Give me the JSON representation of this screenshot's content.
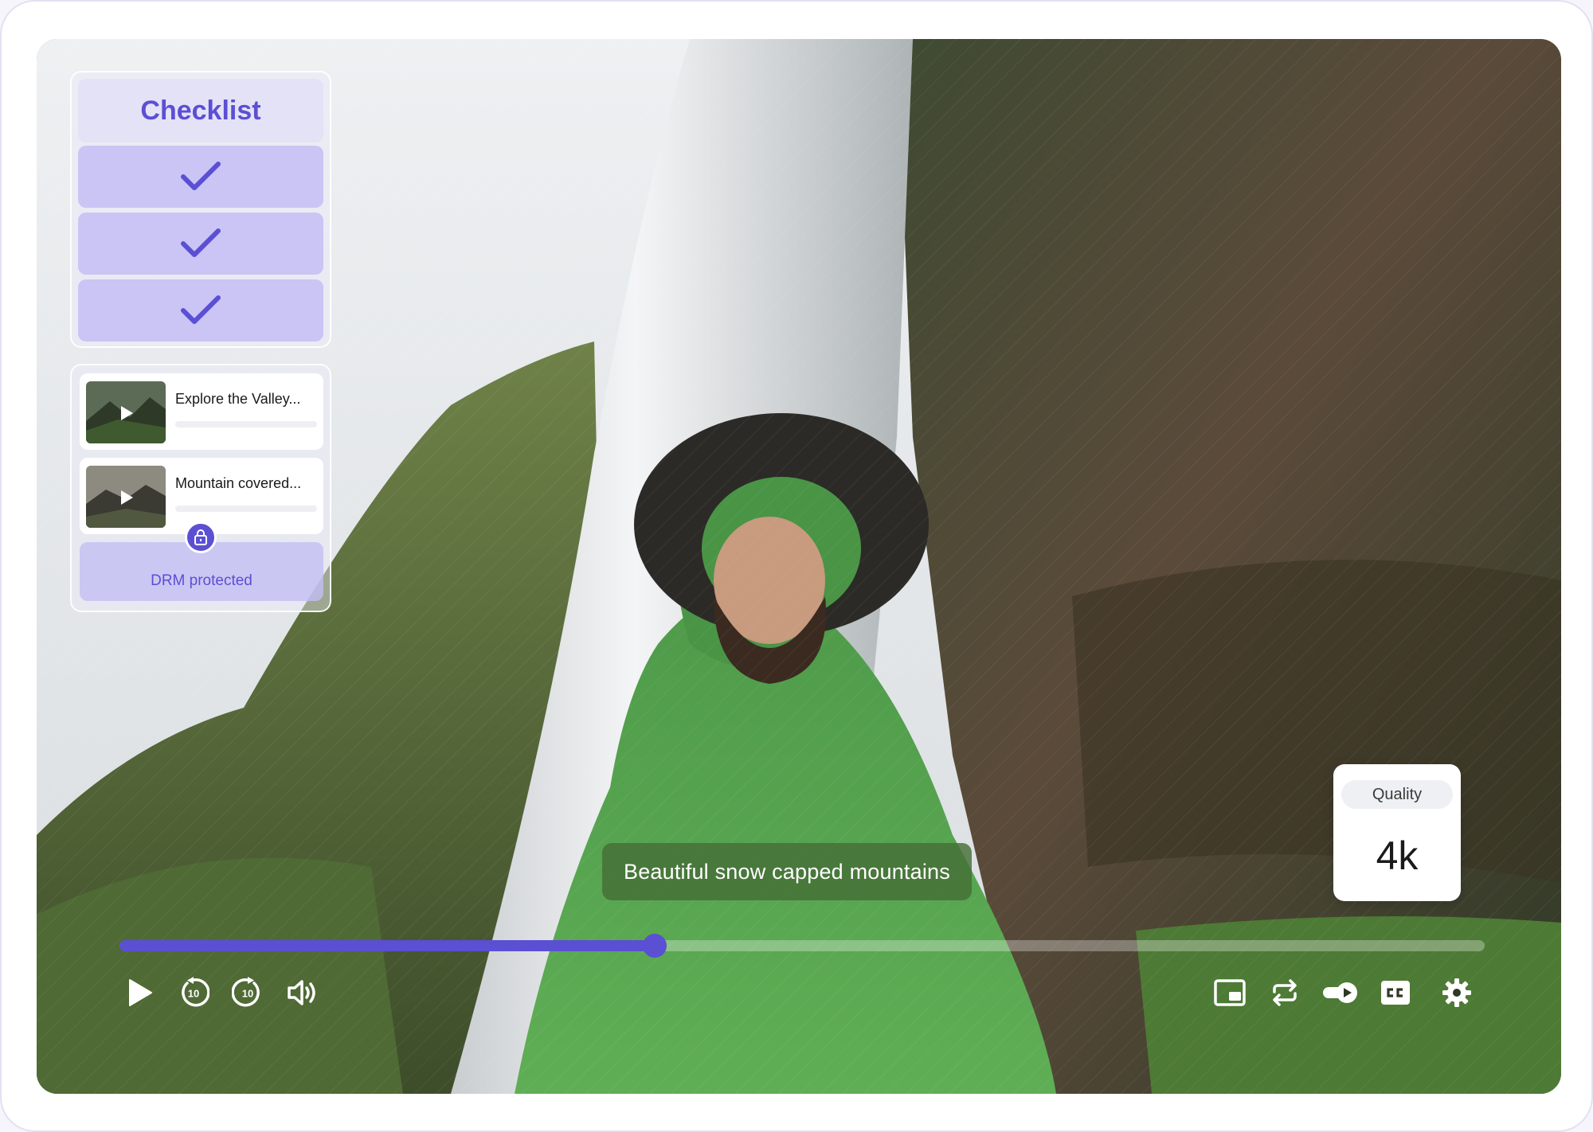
{
  "checklist": {
    "title": "Checklist",
    "items": [
      {
        "checked": true
      },
      {
        "checked": true
      },
      {
        "checked": true
      }
    ]
  },
  "playlist": {
    "items": [
      {
        "title": "Explore the Valley...",
        "progress": 0.0
      },
      {
        "title": "Mountain covered...",
        "progress": 0.0
      }
    ],
    "drm_label": "DRM protected"
  },
  "caption": "Beautiful snow capped mountains",
  "quality": {
    "label": "Quality",
    "value": "4k"
  },
  "playback": {
    "progress": 0.392
  },
  "controls": {
    "left": [
      "play-icon",
      "rewind-10-icon",
      "forward-10-icon",
      "volume-icon"
    ],
    "right": [
      "picture-in-picture-icon",
      "loop-icon",
      "autoplay-icon",
      "closed-captions-icon",
      "settings-icon"
    ]
  },
  "colors": {
    "accent": "#5b4fd4",
    "checklist_row": "#c4bef4",
    "caption_bg": "#466e37"
  }
}
